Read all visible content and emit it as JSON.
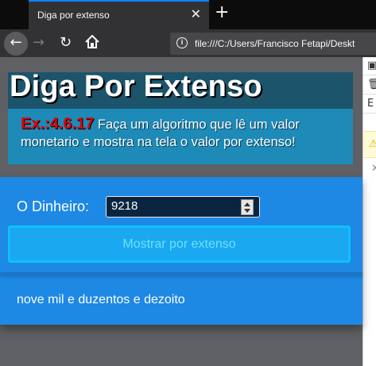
{
  "browser": {
    "tab_title": "Diga por extenso",
    "tab_close": "✕",
    "new_tab": "+",
    "url": "file:///C:/Users/Francisco Fetapi/Deskt"
  },
  "page": {
    "title": "Diga Por Extenso",
    "exercise_number": "Ex.:4.6.17",
    "exercise_text": " Faça um algoritmo que lê um valor monetario e mostra na tela o valor por extenso!"
  },
  "form": {
    "label": "O Dinheiro:",
    "value": "9218",
    "submit_label": "Mostrar por extenso"
  },
  "result": {
    "text": "nove mil e duzentos e dezoito"
  },
  "colors": {
    "accent": "#1e88e5",
    "header_dark": "#1b546b",
    "header_light": "#1d8ab8",
    "exercise_number": "#e00000"
  }
}
